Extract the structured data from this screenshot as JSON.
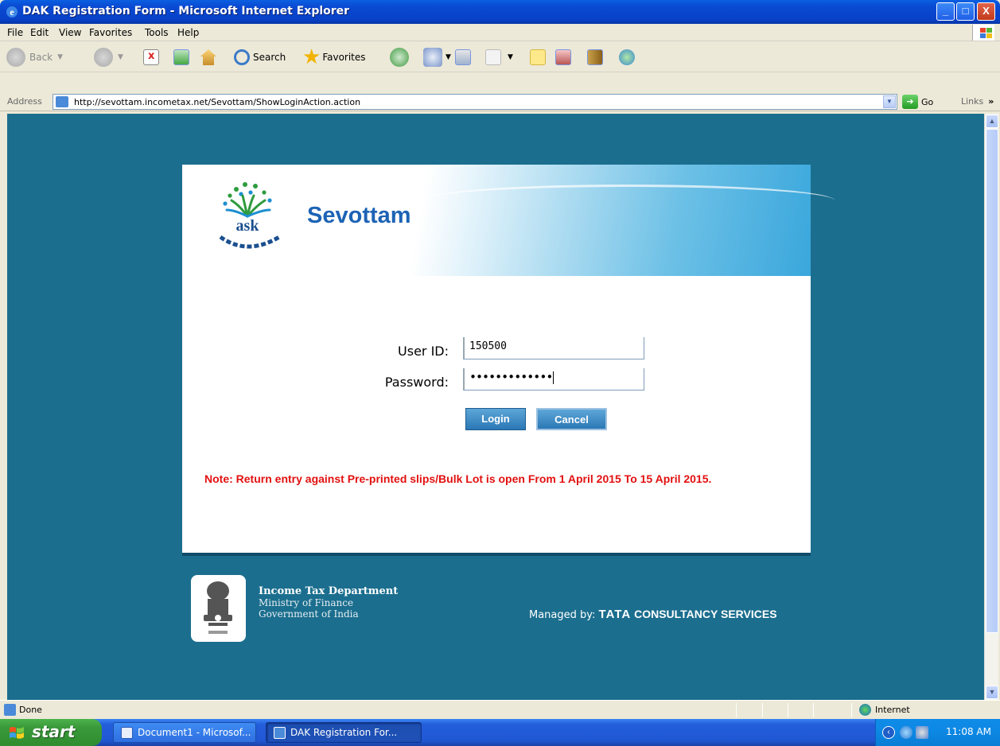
{
  "window": {
    "title": "DAK Registration Form - Microsoft Internet Explorer",
    "min": "_",
    "max": "□",
    "close": "X"
  },
  "menu": [
    "File",
    "Edit",
    "View",
    "Favorites",
    "Tools",
    "Help"
  ],
  "toolbar": {
    "back": "Back",
    "search": "Search",
    "favorites": "Favorites"
  },
  "address": {
    "label": "Address",
    "url": "http://sevottam.incometax.net/Sevottam/ShowLoginAction.action",
    "go": "Go",
    "links": "Links",
    "links_more": "»"
  },
  "page": {
    "brand": "Sevottam",
    "logo_text": "ask",
    "userid_label": "User ID:",
    "userid_value": "150500",
    "password_label": "Password:",
    "password_mask": "•••••••••••••",
    "login_label": "Login",
    "cancel_label": "Cancel",
    "note": "Note: Return entry against Pre-printed slips/Bulk Lot is open From 1 April 2015 To 15 April 2015.",
    "dept_name": "Income Tax Department",
    "dept_ministry": "Ministry of Finance",
    "dept_govt": "Government of India",
    "managed_prefix": "Managed by: ",
    "managed_tata": "TATA",
    "managed_cs": " CONSULTANCY SERVICES",
    "colors": {
      "background": "#1b6e8e",
      "brand": "#1d63b5",
      "note": "#e21010"
    }
  },
  "status": {
    "text": "Done",
    "zone": "Internet"
  },
  "taskbar": {
    "start": "start",
    "task1": "Document1 - Microsof...",
    "task2": "DAK Registration For...",
    "clock": "11:08 AM"
  }
}
